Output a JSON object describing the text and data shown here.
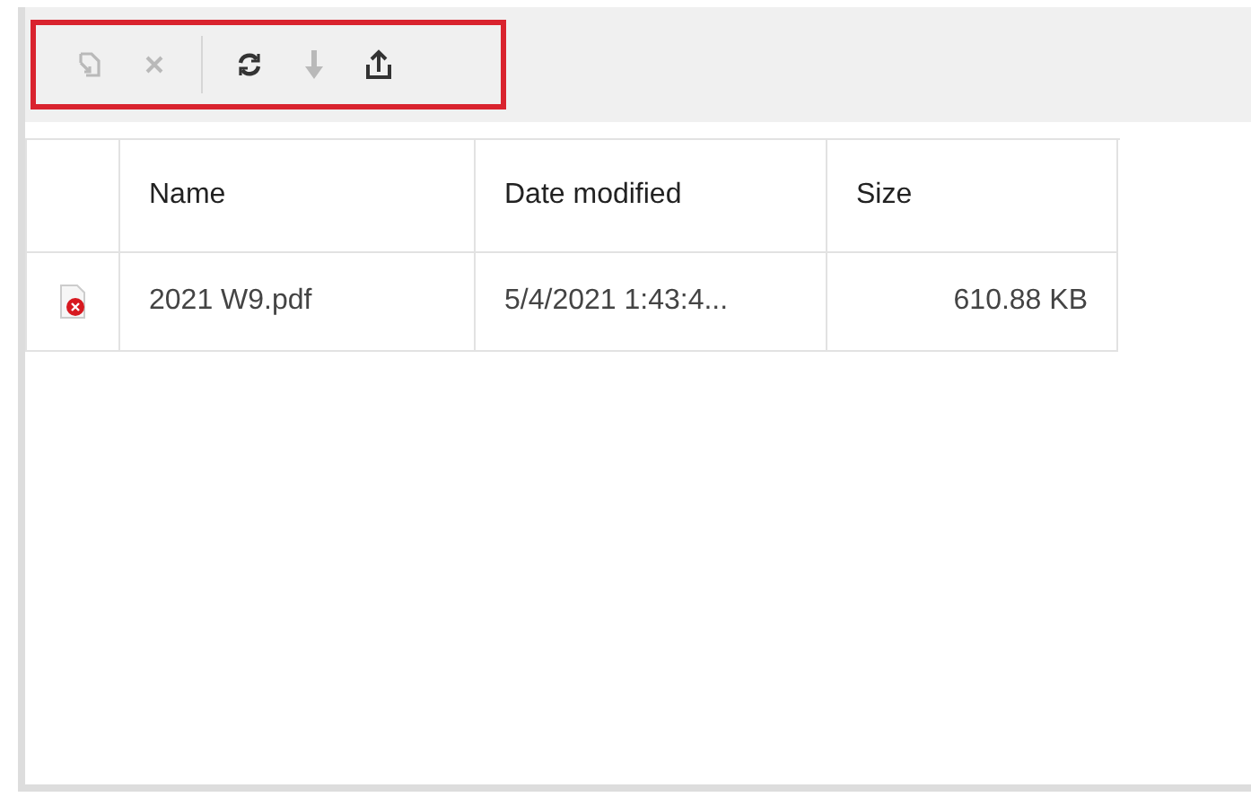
{
  "toolbar": {
    "highlighted": true,
    "groups": [
      [
        {
          "kind": "rename",
          "disabled": true
        },
        {
          "kind": "delete",
          "disabled": true
        }
      ],
      [
        {
          "kind": "refresh",
          "disabled": false
        },
        {
          "kind": "download",
          "disabled": true
        },
        {
          "kind": "upload",
          "disabled": false
        }
      ]
    ]
  },
  "table": {
    "columns": [
      "Name",
      "Date modified",
      "Size"
    ],
    "rows": [
      {
        "kind": "pdf",
        "name": "2021 W9.pdf",
        "date_modified": "5/4/2021 1:43:4...",
        "size": "610.88 KB"
      }
    ]
  }
}
